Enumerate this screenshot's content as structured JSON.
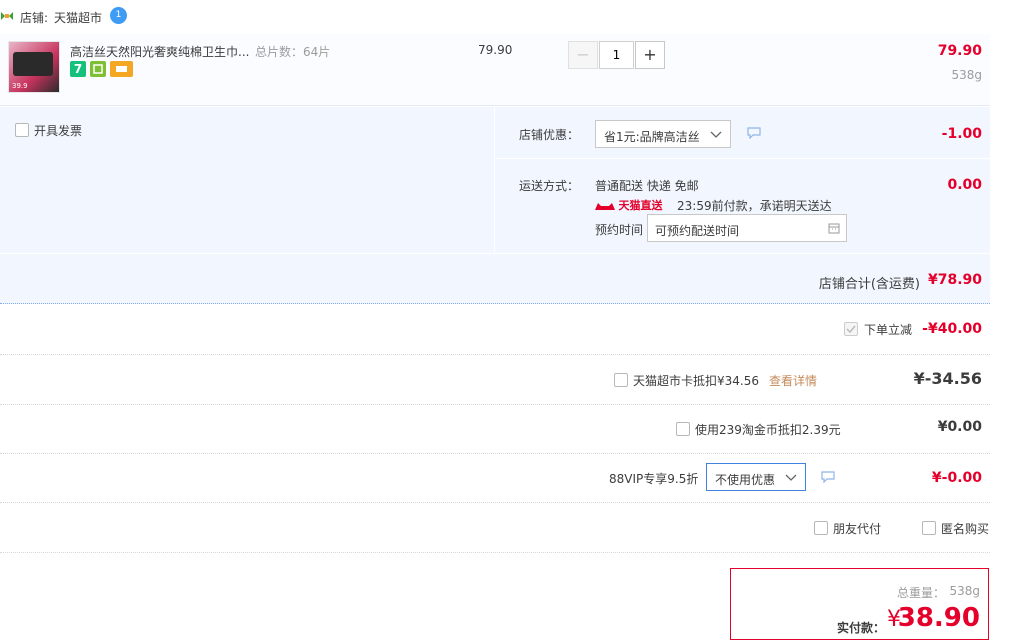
{
  "shop": {
    "label": "店铺:",
    "name": "天猫超市",
    "badge": "1"
  },
  "item": {
    "thumb_caption": "39.9",
    "title": "高洁丝天然阳光奢爽纯棉卫生巾...",
    "spec": "总片数：64片",
    "unit_price": "79.90",
    "quantity": "1",
    "total": "79.90",
    "weight": "538g",
    "service_icon_seven": "7"
  },
  "invoice": {
    "label": "开具发票"
  },
  "shop_discount": {
    "label": "店铺优惠：",
    "selected": "省1元:品牌高洁丝",
    "amount": "-1.00"
  },
  "shipping": {
    "label": "运送方式：",
    "method": "普通配送 快递 免邮",
    "badge": "天猫直送",
    "promise": "23:59前付款，承诺明天送达",
    "appoint_label": "预约时间",
    "appoint_value": "可预约配送时间",
    "amount": "0.00"
  },
  "shop_total": {
    "label": "店铺合计(含运费)",
    "amount": "¥78.90"
  },
  "instant_discount": {
    "label": "下单立减",
    "amount": "-¥40.00"
  },
  "tmall_card": {
    "label": "天猫超市卡抵扣¥34.56",
    "link": "查看详情",
    "amount": "¥-34.56"
  },
  "taojinbi": {
    "label": "使用239淘金币抵扣2.39元",
    "amount": "¥0.00"
  },
  "vip": {
    "label": "88VIP专享9.5折",
    "selected": "不使用优惠",
    "amount": "¥-0.00"
  },
  "options": {
    "friend_pay": "朋友代付",
    "anonymous": "匿名购买"
  },
  "summary": {
    "weight_label": "总重量：",
    "weight": "538g",
    "pay_label": "实付款：",
    "currency": "¥",
    "amount": "38.90"
  },
  "colors": {
    "accent_red": "#e4002b",
    "panel_bg": "#f2f7ff",
    "blue_border": "#b2d1ff"
  }
}
